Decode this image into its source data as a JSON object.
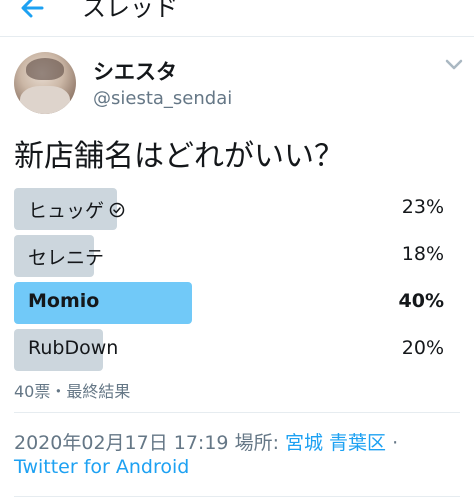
{
  "header": {
    "title": "スレッド",
    "back_icon": "arrow-left-icon",
    "accent": "#1da1f2"
  },
  "tweet": {
    "author_name": "シエスタ",
    "author_handle": "@siesta_sendai",
    "text": "新店舗名はどれがいい？",
    "menu_icon": "chevron-down-icon"
  },
  "poll": {
    "options": [
      {
        "label": "ヒュッゲ",
        "percent": "23%",
        "value": 23,
        "voted": true
      },
      {
        "label": "セレニテ",
        "percent": "18%",
        "value": 18,
        "voted": false
      },
      {
        "label": "Momio",
        "percent": "40%",
        "value": 40,
        "winner": true
      },
      {
        "label": "RubDown",
        "percent": "20%",
        "value": 20,
        "voted": false
      }
    ],
    "summary": "40票・最終結果",
    "bar_color": "#ccd6dd",
    "winner_color": "#71c9f8"
  },
  "meta": {
    "timestamp": "2020年02月17日 17:19",
    "place_prefix": "場所:",
    "place": "宮城 青葉区",
    "separator": "·",
    "source": "Twitter for Android"
  }
}
